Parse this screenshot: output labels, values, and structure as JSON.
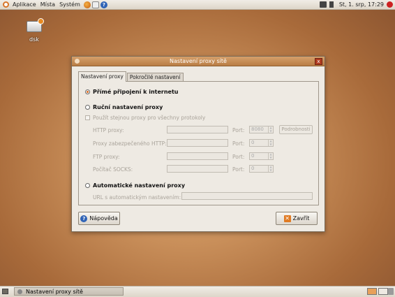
{
  "top_panel": {
    "menus": [
      "Aplikace",
      "Místa",
      "Systém"
    ],
    "clock": "St, 1. srp, 17:29"
  },
  "desktop": {
    "icon_label": "dsk"
  },
  "dialog": {
    "title": "Nastavení proxy sítě",
    "close_glyph": "x",
    "tabs": [
      "Nastavení proxy",
      "Pokročilé nastavení"
    ],
    "direct": "Přímé připojení k internetu",
    "manual": "Ruční nastavení proxy",
    "same_proxy": "Použít stejnou proxy pro všechny protokoly",
    "http_label": "HTTP proxy:",
    "https_label": "Proxy zabezpečeného HTTP:",
    "ftp_label": "FTP proxy:",
    "socks_label": "Počítač SOCKS:",
    "port_label": "Port:",
    "http_port": "8080",
    "https_port": "0",
    "ftp_port": "0",
    "socks_port": "0",
    "details_button": "Podrobnosti",
    "auto": "Automatické nastavení proxy",
    "autoconfig_label": "URL s automatickým nastavením:",
    "help_button": "Nápověda",
    "close_button": "Zavřít"
  },
  "bottom_panel": {
    "task_label": "Nastavení proxy sítě"
  }
}
